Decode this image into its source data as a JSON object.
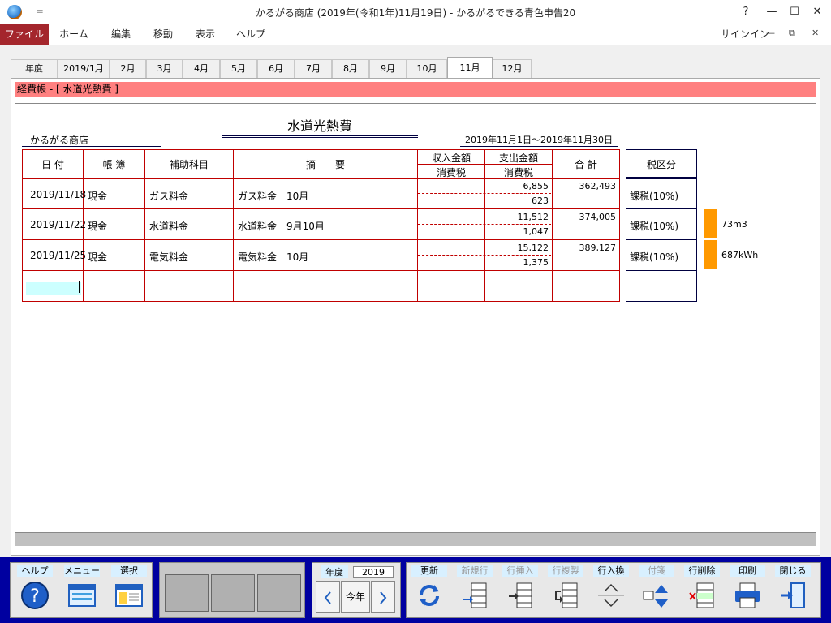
{
  "window": {
    "title": "かるがる商店 (2019年(令和1年)11月19日) - かるがるできる青色申告20",
    "quick_access": "＝",
    "help": "?",
    "minimize": "—",
    "maximize": "☐",
    "close": "✕"
  },
  "ribbon": {
    "tabs": [
      "ファイル",
      "ホーム",
      "編集",
      "移動",
      "表示",
      "ヘルプ"
    ],
    "signin": "サインイン",
    "mini_minimize": "—",
    "mini_restore": "⧉",
    "mini_close": "✕"
  },
  "month_tabs": [
    "年度",
    "2019/1月",
    "2月",
    "3月",
    "4月",
    "5月",
    "6月",
    "7月",
    "8月",
    "9月",
    "10月",
    "11月",
    "12月"
  ],
  "active_month": "11月",
  "ledger": {
    "header": "経費帳 - [ 水道光熱費 ]",
    "title": "水道光熱費",
    "shop": "かるがる商店",
    "period": "2019年11月1日～2019年11月30日",
    "columns": {
      "date": "日 付",
      "book": "帳 簿",
      "sub": "補助科目",
      "desc": "摘　　要",
      "income": "収入金額",
      "income_tax": "消費税",
      "expense": "支出金額",
      "expense_tax": "消費税",
      "total": "合 計",
      "tax_class": "税区分"
    },
    "rows": [
      {
        "date": "2019/11/18",
        "book": "現金",
        "sub": "ガス料金",
        "desc": "ガス料金　10月",
        "expense": "6,855",
        "expense_tax": "623",
        "total": "362,493",
        "tax_class": "課税(10%)",
        "memo": ""
      },
      {
        "date": "2019/11/22",
        "book": "現金",
        "sub": "水道料金",
        "desc": "水道料金　9月10月",
        "expense": "11,512",
        "expense_tax": "1,047",
        "total": "374,005",
        "tax_class": "課税(10%)",
        "memo": "73m3"
      },
      {
        "date": "2019/11/25",
        "book": "現金",
        "sub": "電気料金",
        "desc": "電気料金　10月",
        "expense": "15,122",
        "expense_tax": "1,375",
        "total": "389,127",
        "tax_class": "課税(10%)",
        "memo": "687kWh"
      }
    ]
  },
  "toolbar": {
    "help": "ヘルプ",
    "menu": "メニュー",
    "select": "選択",
    "year_label": "年度",
    "year_value": "2019",
    "today": "今年",
    "update": "更新",
    "new_row": "新規行",
    "insert_row": "行挿入",
    "copy_row": "行複製",
    "swap_row": "行入換",
    "tag": "付箋",
    "delete_row": "行削除",
    "print": "印刷",
    "close": "閉じる",
    "accent": "#0000a0"
  }
}
